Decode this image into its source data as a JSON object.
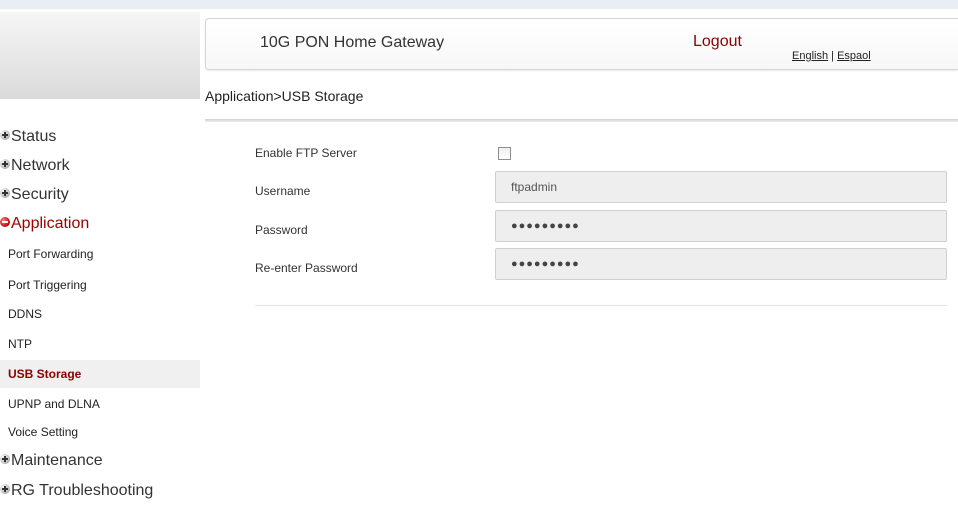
{
  "header": {
    "title": "10G PON Home Gateway",
    "logout": "Logout",
    "lang_english": "English",
    "lang_separator": " | ",
    "lang_spanish": "Espaol"
  },
  "breadcrumb": "Application>USB Storage",
  "sidebar": {
    "sections": [
      {
        "label": "Status",
        "icon": "plus-bullet-icon"
      },
      {
        "label": "Network",
        "icon": "plus-bullet-icon"
      },
      {
        "label": "Security",
        "icon": "plus-bullet-icon"
      },
      {
        "label": "Application",
        "icon": "minus-bullet-icon",
        "expanded": true
      },
      {
        "label": "Maintenance",
        "icon": "plus-bullet-icon"
      },
      {
        "label": "RG Troubleshooting",
        "icon": "plus-bullet-icon"
      }
    ],
    "application_items": [
      {
        "label": "Port Forwarding"
      },
      {
        "label": "Port Triggering"
      },
      {
        "label": "DDNS"
      },
      {
        "label": "NTP"
      },
      {
        "label": "USB Storage",
        "selected": true
      },
      {
        "label": "UPNP and DLNA"
      },
      {
        "label": "Voice Setting"
      }
    ]
  },
  "form": {
    "enable_ftp_label": "Enable FTP Server",
    "enable_ftp_checked": false,
    "username_label": "Username",
    "username_value": "ftpadmin",
    "password_label": "Password",
    "password_value": "●●●●●●●●●",
    "reenter_label": "Re-enter Password",
    "reenter_value": "●●●●●●●●●"
  },
  "colors": {
    "accent": "#8b0000",
    "active_section": "#a00000"
  }
}
